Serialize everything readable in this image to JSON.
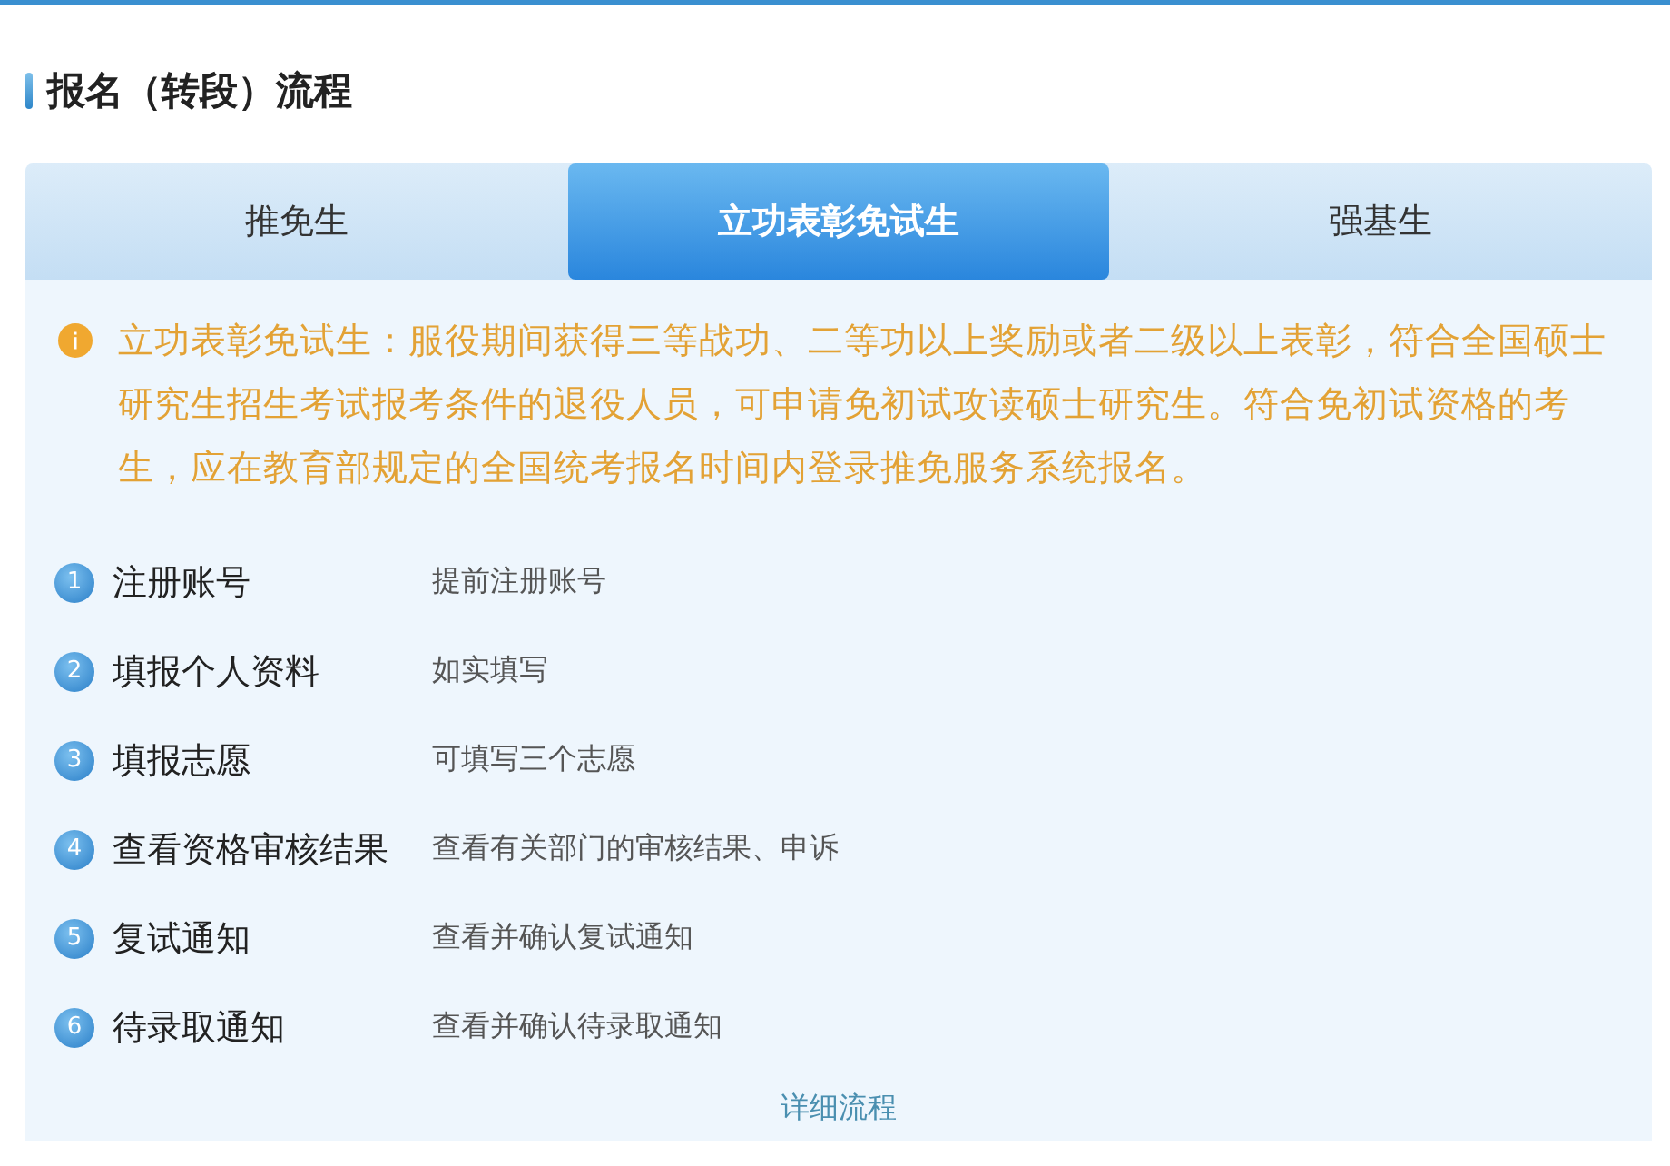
{
  "title": "报名（转段）流程",
  "tabs": [
    {
      "label": "推免生",
      "selected": false
    },
    {
      "label": "立功表彰免试生",
      "selected": true
    },
    {
      "label": "强基生",
      "selected": false
    }
  ],
  "notice": "立功表彰免试生：服役期间获得三等战功、二等功以上奖励或者二级以上表彰，符合全国硕士研究生招生考试报考条件的退役人员，可申请免初试攻读硕士研究生。符合免初试资格的考生，应在教育部规定的全国统考报名时间内登录推免服务系统报名。",
  "steps": [
    {
      "number": "1",
      "title": "注册账号",
      "description": "提前注册账号"
    },
    {
      "number": "2",
      "title": "填报个人资料",
      "description": "如实填写"
    },
    {
      "number": "3",
      "title": "填报志愿",
      "description": "可填写三个志愿"
    },
    {
      "number": "4",
      "title": "查看资格审核结果",
      "description": "查看有关部门的审核结果、申诉"
    },
    {
      "number": "5",
      "title": "复试通知",
      "description": "查看并确认复试通知"
    },
    {
      "number": "6",
      "title": "待录取通知",
      "description": "查看并确认待录取通知"
    }
  ],
  "link": "详细流程"
}
